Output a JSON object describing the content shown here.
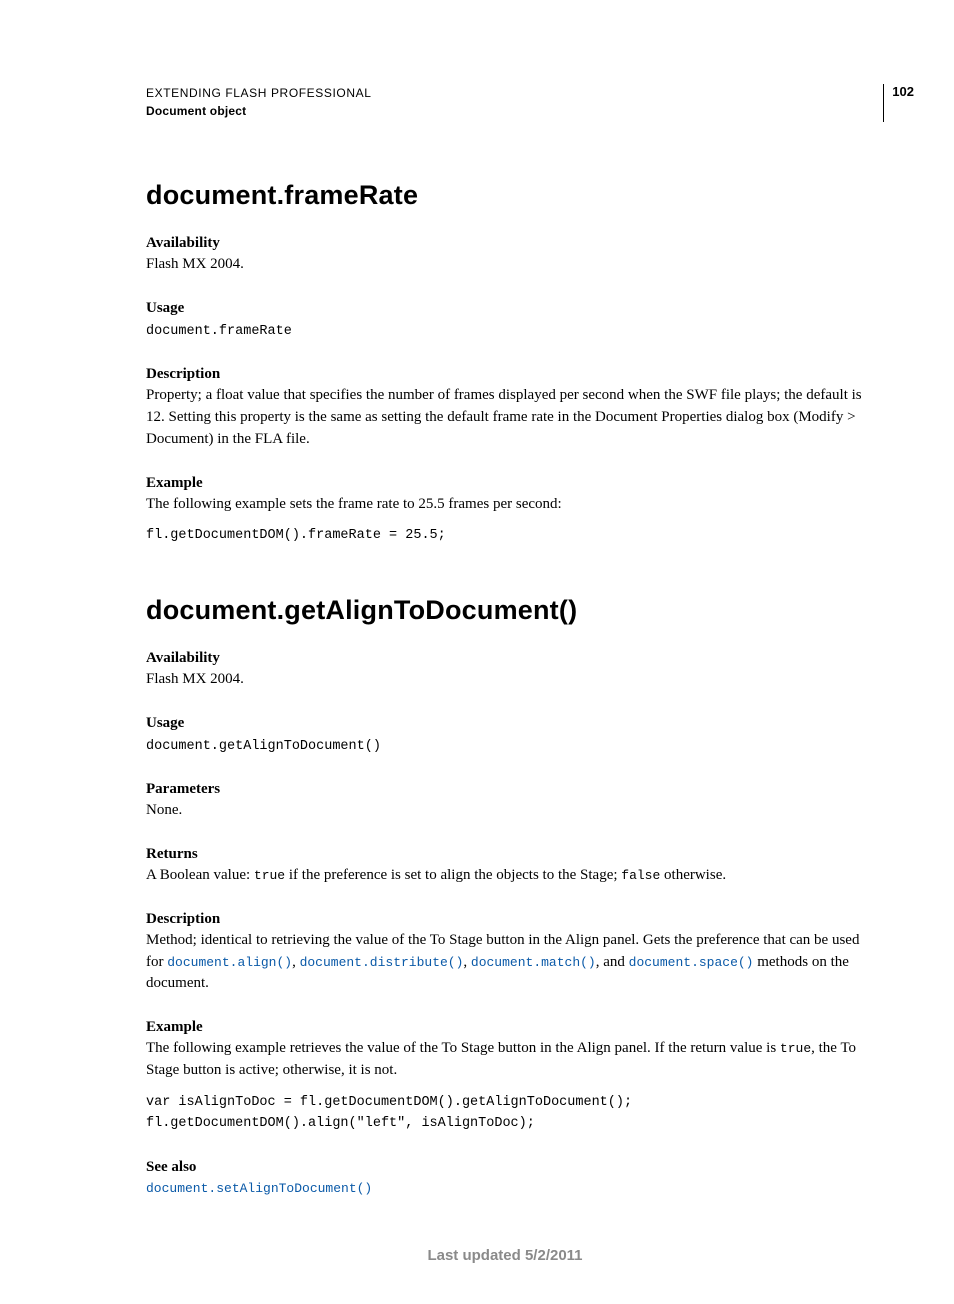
{
  "header": {
    "title": "EXTENDING FLASH PROFESSIONAL",
    "subtitle": "Document object",
    "page": "102"
  },
  "section1": {
    "heading": "document.frameRate",
    "availability_label": "Availability",
    "availability_text": "Flash MX 2004.",
    "usage_label": "Usage",
    "usage_code": "document.frameRate",
    "description_label": "Description",
    "description_text": "Property; a float value that specifies the number of frames displayed per second when the SWF file plays; the default is 12. Setting this property is the same as setting the default frame rate in the Document Properties dialog box (Modify > Document) in the FLA file.",
    "example_label": "Example",
    "example_intro": "The following example sets the frame rate to 25.5 frames per second:",
    "example_code": "fl.getDocumentDOM().frameRate = 25.5;"
  },
  "section2": {
    "heading": "document.getAlignToDocument()",
    "availability_label": "Availability",
    "availability_text": "Flash MX 2004.",
    "usage_label": "Usage",
    "usage_code": "document.getAlignToDocument()",
    "parameters_label": "Parameters",
    "parameters_text": "None.",
    "returns_label": "Returns",
    "returns_pre": "A Boolean value: ",
    "returns_true": "true",
    "returns_mid": " if the preference is set to align the objects to the Stage; ",
    "returns_false": "false",
    "returns_post": " otherwise.",
    "description_label": "Description",
    "desc_pre": "Method; identical to retrieving the value of the To Stage button in the Align panel. Gets the preference that can be used for ",
    "link1": "document.align()",
    "sep1": ", ",
    "link2": "document.distribute()",
    "sep2": ", ",
    "link3": "document.match()",
    "sep3": ", and ",
    "link4": "document.space()",
    "desc_post": " methods on the document.",
    "example_label": "Example",
    "example_intro_pre": "The following example retrieves the value of the To Stage button in the Align panel. If the return value is ",
    "example_intro_true": "true",
    "example_intro_post": ", the To Stage button is active; otherwise, it is not.",
    "example_code": "var isAlignToDoc = fl.getDocumentDOM().getAlignToDocument();\nfl.getDocumentDOM().align(\"left\", isAlignToDoc);",
    "seealso_label": "See also",
    "seealso_link": "document.setAlignToDocument()"
  },
  "footer": "Last updated 5/2/2011"
}
